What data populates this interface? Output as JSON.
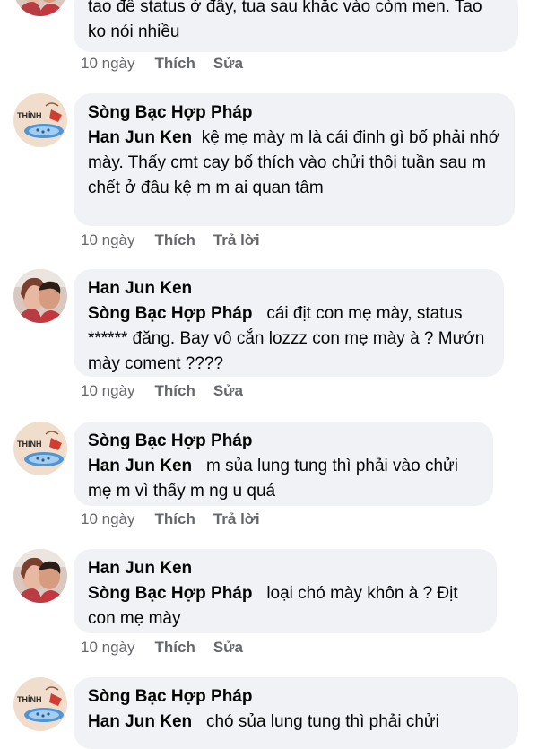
{
  "comments": [
    {
      "author": "",
      "mention": "",
      "text": "tao để status ở đây, tua sau khắc vào còm men. Tao ko nói nhiều",
      "time": "10 ngày",
      "like": "Thích",
      "second_action": "Sửa",
      "avatar": "photo-avatar"
    },
    {
      "author": "Sòng Bạc Hợp Pháp",
      "mention": "Han Jun Ken",
      "text": "kệ mẹ mày m là cái đinh gì bố phải nhớ mày. Thấy cmt cay bố thích vào chửi thôi tuần sau m chết ở đâu kệ m m ai quan tâm",
      "time": "10 ngày",
      "like": "Thích",
      "second_action": "Trả lời",
      "avatar": "thinh-logo-avatar",
      "avatar_label": "THÍNH"
    },
    {
      "author": "Han Jun Ken",
      "mention": "Sòng Bạc Hợp Pháp",
      "text": "cái địt con mẹ mày, status ****** đăng. Bay vô cắn lozzz con mẹ mày à ? Mướn mày coment ????",
      "time": "10 ngày",
      "like": "Thích",
      "second_action": "Sửa",
      "avatar": "photo-avatar"
    },
    {
      "author": "Sòng Bạc Hợp Pháp",
      "mention": "Han Jun Ken",
      "text": "m sủa lung tung thì phải vào chửi  mẹ m vì thấy m ng u quá",
      "time": "10 ngày",
      "like": "Thích",
      "second_action": "Trả lời",
      "avatar": "thinh-logo-avatar",
      "avatar_label": "THÍNH"
    },
    {
      "author": "Han Jun Ken",
      "mention": "Sòng Bạc Hợp Pháp",
      "text": "loại chó mày khôn à ? Địt con mẹ mày",
      "time": "10 ngày",
      "like": "Thích",
      "second_action": "Sửa",
      "avatar": "photo-avatar"
    },
    {
      "author": "Sòng Bạc Hợp Pháp",
      "mention": "Han Jun Ken",
      "text": "chó sủa lung tung thì phải chửi",
      "time": "",
      "like": "",
      "second_action": "",
      "avatar": "thinh-logo-avatar",
      "avatar_label": "THÍNH"
    }
  ],
  "colors": {
    "bubble": "#f0f2f5",
    "meta_text": "#65676b",
    "text": "#050505"
  }
}
